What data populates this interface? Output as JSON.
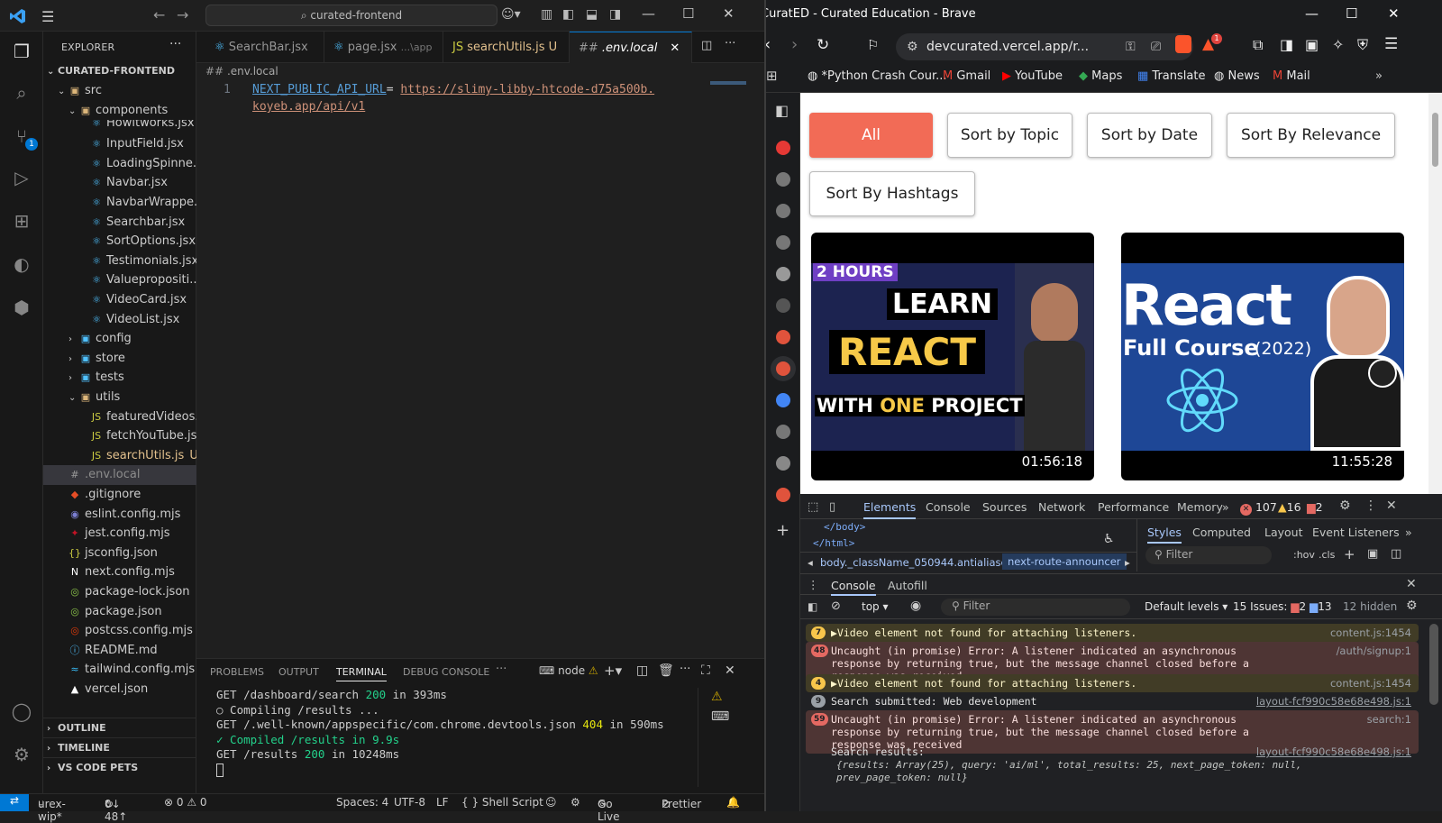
{
  "vscode": {
    "search_box": "curated-frontend",
    "explorer": {
      "title": "EXPLORER",
      "root": "CURATED-FRONTEND",
      "items": [
        {
          "label": "src",
          "depth": 1,
          "kind": "folder-open"
        },
        {
          "label": "components",
          "depth": 2,
          "kind": "folder-open"
        },
        {
          "label": "Howitworks.jsx",
          "depth": 3,
          "kind": "react"
        },
        {
          "label": "InputField.jsx",
          "depth": 3,
          "kind": "react"
        },
        {
          "label": "LoadingSpinne...",
          "depth": 3,
          "kind": "react"
        },
        {
          "label": "Navbar.jsx",
          "depth": 3,
          "kind": "react"
        },
        {
          "label": "NavbarWrappe...",
          "depth": 3,
          "kind": "react"
        },
        {
          "label": "Searchbar.jsx",
          "depth": 3,
          "kind": "react"
        },
        {
          "label": "SortOptions.jsx",
          "depth": 3,
          "kind": "react"
        },
        {
          "label": "Testimonials.jsx",
          "depth": 3,
          "kind": "react"
        },
        {
          "label": "Valuepropositi...",
          "depth": 3,
          "kind": "react"
        },
        {
          "label": "VideoCard.jsx",
          "depth": 3,
          "kind": "react"
        },
        {
          "label": "VideoList.jsx",
          "depth": 3,
          "kind": "react"
        },
        {
          "label": "config",
          "depth": 2,
          "kind": "folder"
        },
        {
          "label": "store",
          "depth": 2,
          "kind": "folder"
        },
        {
          "label": "tests",
          "depth": 2,
          "kind": "folder"
        },
        {
          "label": "utils",
          "depth": 2,
          "kind": "folder-open"
        },
        {
          "label": "featuredVideos...",
          "depth": 3,
          "kind": "js"
        },
        {
          "label": "fetchYouTube.js",
          "depth": 3,
          "kind": "js"
        },
        {
          "label": "searchUtils.js",
          "depth": 3,
          "kind": "js",
          "status": "U"
        },
        {
          "label": ".env.local",
          "depth": 1,
          "kind": "env"
        },
        {
          "label": ".gitignore",
          "depth": 1,
          "kind": "git"
        },
        {
          "label": "eslint.config.mjs",
          "depth": 1,
          "kind": "eslint"
        },
        {
          "label": "jest.config.mjs",
          "depth": 1,
          "kind": "jest"
        },
        {
          "label": "jsconfig.json",
          "depth": 1,
          "kind": "json"
        },
        {
          "label": "next.config.mjs",
          "depth": 1,
          "kind": "next"
        },
        {
          "label": "package-lock.json",
          "depth": 1,
          "kind": "npm"
        },
        {
          "label": "package.json",
          "depth": 1,
          "kind": "npm"
        },
        {
          "label": "postcss.config.mjs",
          "depth": 1,
          "kind": "postcss"
        },
        {
          "label": "README.md",
          "depth": 1,
          "kind": "info"
        },
        {
          "label": "tailwind.config.mjs",
          "depth": 1,
          "kind": "tailwind"
        },
        {
          "label": "vercel.json",
          "depth": 1,
          "kind": "vercel"
        }
      ],
      "sections": [
        "OUTLINE",
        "TIMELINE",
        "VS CODE PETS"
      ]
    },
    "tabs": [
      {
        "label": "SearchBar.jsx",
        "icon": "react"
      },
      {
        "label": "page.jsx",
        "hint": "...\\app",
        "icon": "react"
      },
      {
        "label": "searchUtils.js",
        "status": "U",
        "icon": "js"
      },
      {
        "label": ".env.local",
        "icon": "env",
        "active": true
      }
    ],
    "breadcrumb": ".env.local",
    "editor": {
      "line_number": "1",
      "key": "NEXT_PUBLIC_API_URL",
      "eq": "=",
      "value_line1": "https://slimy-libby-htcode-d75a500b.",
      "value_line2": "koyeb.app/api/v1"
    },
    "panel": {
      "tabs": [
        "PROBLEMS",
        "OUTPUT",
        "TERMINAL",
        "DEBUG CONSOLE"
      ],
      "active_tab": "TERMINAL",
      "shell": "node",
      "lines": [
        {
          "pre": "GET /dashboard/search ",
          "code": "200",
          "post": " in 393ms"
        },
        {
          "pre": "○ Compiling /results ...",
          "code": "",
          "post": ""
        },
        {
          "pre": "GET /.well-known/appspecific/com.chrome.devtools.json ",
          "code": "404",
          "post": " in 590ms"
        },
        {
          "pre": "✓ Compiled /results in 9.9s",
          "code": "",
          "post": ""
        },
        {
          "pre": "GET /results ",
          "code": "200",
          "post": " in 10248ms"
        }
      ]
    },
    "status": {
      "branch": "urex-wip*",
      "sync": "0↓ 48↑",
      "problems": "⊗ 0 ⚠ 0",
      "spaces": "Spaces: 4",
      "encoding": "UTF-8",
      "eol": "LF",
      "language": "{ } Shell Script",
      "golive": "Go Live",
      "prettier": "Prettier"
    }
  },
  "brave": {
    "window_title": "CuratED - Curated Education - Brave",
    "url": "devcurated.vercel.app/r...",
    "alerts_badge": "1",
    "bookmarks": [
      "*Python Crash Cour...",
      "Gmail",
      "YouTube",
      "Maps",
      "Translate",
      "News",
      "Mail"
    ],
    "sort_buttons": [
      "All",
      "Sort by Topic",
      "Sort by Date",
      "Sort By Relevance",
      "Sort By Hashtags"
    ],
    "videos": [
      {
        "line1": "2 HOURS",
        "line2": "LEARN",
        "line3": "REACT",
        "line4a": "WITH ",
        "line4b": "ONE",
        "line4c": " PROJECT",
        "duration": "01:56:18"
      },
      {
        "line1": "React",
        "line2": "Full Course",
        "line3": "(2022)",
        "duration": "11:55:28"
      }
    ],
    "devtools": {
      "tabs": [
        "Elements",
        "Console",
        "Sources",
        "Network",
        "Performance",
        "Memory"
      ],
      "error_count": "107",
      "warning_count": "16",
      "info_count": "2",
      "dom_lines": [
        "</body>",
        "</html>"
      ],
      "crumbs": [
        "body._className_050944.antialiased",
        "next-route-announcer"
      ],
      "style_tabs": [
        "Styles",
        "Computed",
        "Layout",
        "Event Listeners"
      ],
      "filter_placeholder": "Filter",
      "hov": ":hov",
      "cls": ".cls",
      "drawer_tabs": [
        "Console",
        "Autofill"
      ],
      "context": "top",
      "levels": "Default levels",
      "issues": "15 Issues:",
      "issue_err": "2",
      "issue_info": "13",
      "hidden": "12 hidden",
      "messages": [
        {
          "type": "warn",
          "count": "7",
          "text": "▶Video element not found for attaching listeners.",
          "src": "content.js:1454"
        },
        {
          "type": "err",
          "count": "48",
          "text": "Uncaught (in promise) Error: A listener indicated an asynchronous response by returning true, but the message channel closed before a response was received",
          "src": "/auth/signup:1"
        },
        {
          "type": "warn",
          "count": "4",
          "text": "▶Video element not found for attaching listeners.",
          "src": "content.js:1454"
        },
        {
          "type": "log",
          "count": "9",
          "text": "Search submitted: Web development",
          "src": "layout-fcf990c58e68e498.js:1"
        },
        {
          "type": "err",
          "count": "59",
          "text": "Uncaught (in promise) Error: A listener indicated an asynchronous response by returning true, but the message channel closed before a response was received",
          "src": "search:1"
        },
        {
          "type": "log",
          "count": "",
          "text": "Search results:",
          "src": "layout-fcf990c58e68e498.js:1"
        }
      ],
      "results_obj": "{results: Array(25), query: 'ai/ml', total_results: 25, next_page_token: null, prev_page_token: null}"
    }
  }
}
